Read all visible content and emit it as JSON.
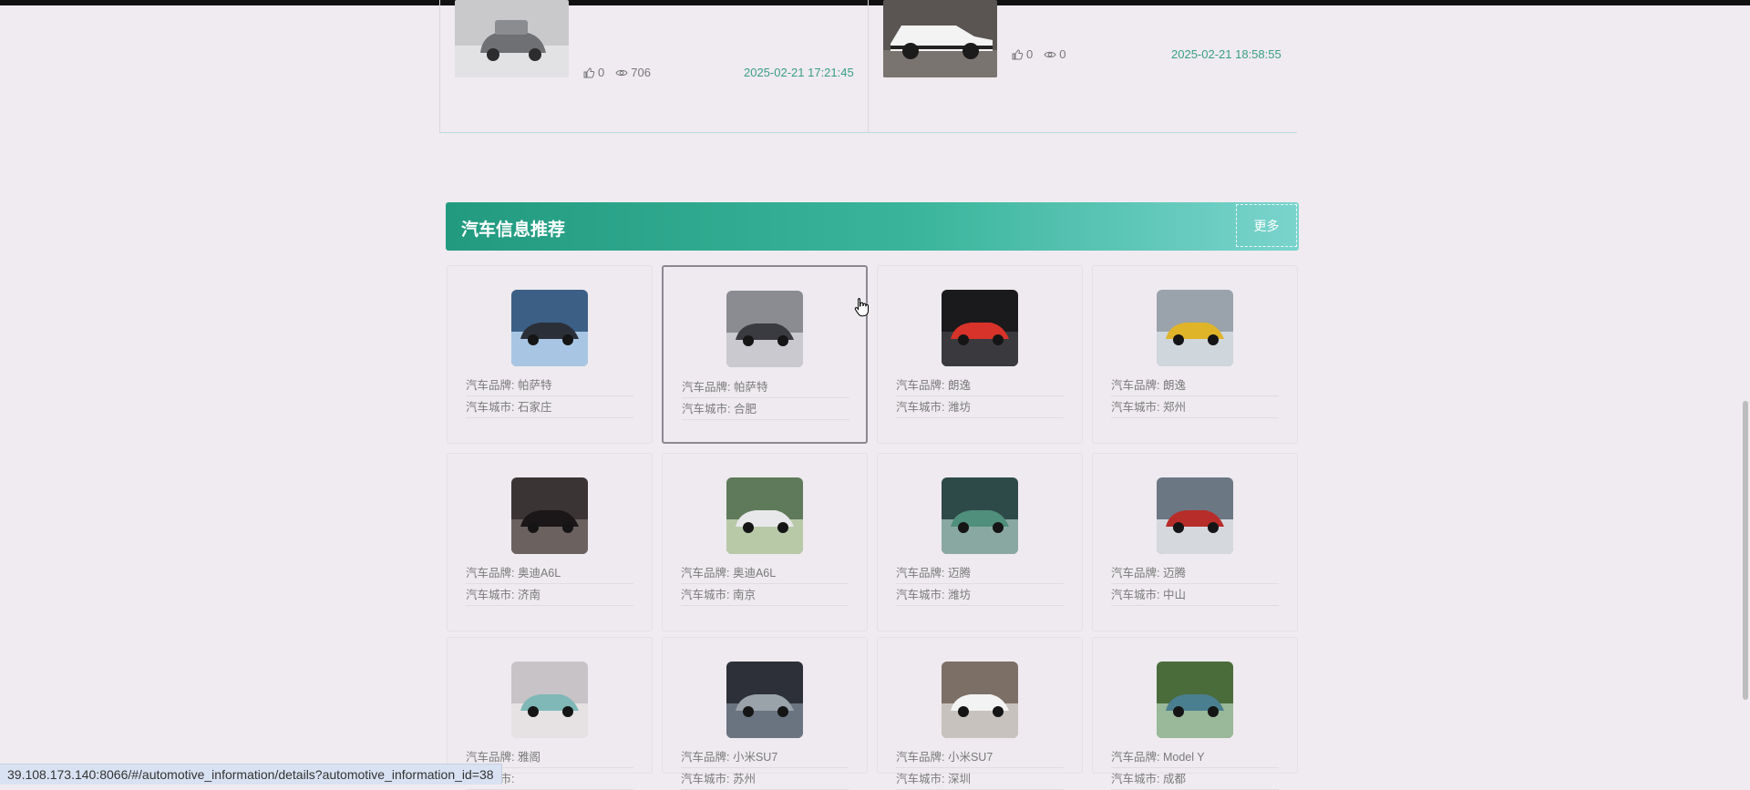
{
  "news": [
    {
      "likes": "0",
      "views": "706",
      "date": "2025-02-21 17:21:45"
    },
    {
      "likes": "0",
      "views": "0",
      "date": "2025-02-21 18:58:55"
    }
  ],
  "section": {
    "title": "汽车信息推荐",
    "more_label": "更多"
  },
  "field_labels": {
    "brand": "汽车品牌: ",
    "city": "汽车城市: "
  },
  "cars": [
    {
      "brand": "帕萨特",
      "city": "石家庄",
      "image": "blue-sedan-car-photo"
    },
    {
      "brand": "帕萨特",
      "city": "合肥",
      "image": "dark-suv-car-photo"
    },
    {
      "brand": "朗逸",
      "city": "潍坊",
      "image": "red-sports-car-photo"
    },
    {
      "brand": "朗逸",
      "city": "郑州",
      "image": "yellow-offroad-car-photo"
    },
    {
      "brand": "奥迪A6L",
      "city": "济南",
      "image": "black-luxury-suv-photo"
    },
    {
      "brand": "奥迪A6L",
      "city": "南京",
      "image": "white-suv-photo"
    },
    {
      "brand": "迈腾",
      "city": "潍坊",
      "image": "green-sports-car-photo"
    },
    {
      "brand": "迈腾",
      "city": "中山",
      "image": "red-coupe-photo"
    },
    {
      "brand": "雅阁",
      "city": "",
      "image": "mint-mini-car-photo"
    },
    {
      "brand": "小米SU7",
      "city": "苏州",
      "image": "grey-sedan-photo"
    },
    {
      "brand": "小米SU7",
      "city": "深圳",
      "image": "white-sports-car-photo"
    },
    {
      "brand": "Model Y",
      "city": "成都",
      "image": "teal-car-road-photo"
    }
  ],
  "status_url": "39.108.173.140:8066/#/automotive_information/details?automotive_information_id=38",
  "colors": {
    "accent": "#229a80",
    "date": "#3a9d85",
    "background": "#efebf0"
  }
}
